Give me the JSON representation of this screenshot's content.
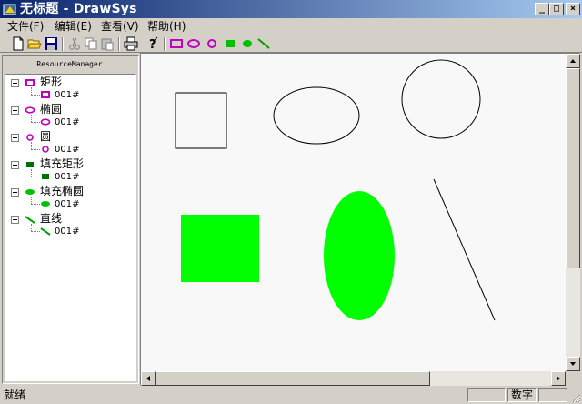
{
  "window": {
    "title": "无标题 - DrawSys",
    "controls": {
      "minimize": "_",
      "maximize": "□",
      "close": "×"
    }
  },
  "menu": [
    {
      "label": "文件(F)"
    },
    {
      "label": "编辑(E)"
    },
    {
      "label": "查看(V)"
    },
    {
      "label": "帮助(H)"
    }
  ],
  "toolbar": {
    "icons": [
      "new-file-icon",
      "open-folder-icon",
      "save-disk-icon",
      "cut-icon",
      "copy-icon",
      "paste-icon",
      "print-icon",
      "help-icon",
      "rectangle-tool-icon",
      "ellipse-tool-icon",
      "circle-tool-icon",
      "filled-rectangle-tool-icon",
      "filled-ellipse-tool-icon",
      "line-tool-icon"
    ],
    "shape_color": "#c000c0",
    "fill_color": "#00c000",
    "line_color": "#00a000"
  },
  "resource_manager": {
    "title": "ResourceManager",
    "groups": [
      {
        "label": "矩形",
        "icon": "rectangle-icon",
        "child": "001#"
      },
      {
        "label": "椭圆",
        "icon": "ellipse-icon",
        "child": "001#"
      },
      {
        "label": "圆",
        "icon": "circle-icon",
        "child": "001#"
      },
      {
        "label": "填充矩形",
        "icon": "filled-rectangle-icon",
        "child": "001#"
      },
      {
        "label": "填充椭圆",
        "icon": "filled-ellipse-icon",
        "child": "001#"
      },
      {
        "label": "直线",
        "icon": "line-icon",
        "child": "001#"
      }
    ]
  },
  "canvas": {
    "background": "#f8f8f8",
    "fill_color": "#00ff00",
    "stroke_color": "#000000"
  },
  "statusbar": {
    "text": "就绪",
    "panes": [
      "",
      "数字",
      ""
    ]
  }
}
